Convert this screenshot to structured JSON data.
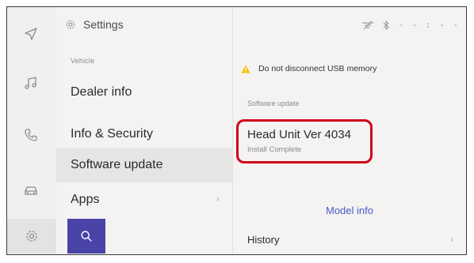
{
  "header": {
    "title": "Settings"
  },
  "status": {
    "clock": "- - : - -",
    "icons": [
      "signal-icon",
      "bluetooth-icon"
    ]
  },
  "menu": {
    "section_label": "Vehicle",
    "items": [
      {
        "label": "Dealer info"
      },
      {
        "label": "Info & Security"
      },
      {
        "label": "Software update",
        "selected": true
      },
      {
        "label": "Apps",
        "chevron": "›"
      }
    ]
  },
  "rail": {
    "icons": [
      "navigation-icon",
      "music-icon",
      "phone-icon",
      "car-icon",
      "settings-icon"
    ],
    "active": "settings-icon"
  },
  "content": {
    "warning": "Do not disconnect USB memory",
    "section_label": "Software update",
    "head_unit_title": "Head Unit Ver 4034",
    "head_unit_status": "Install Complete",
    "model_info": "Model info",
    "history": "History",
    "history_chevron": "›"
  },
  "colors": {
    "accent": "#4a44a8",
    "highlight": "#d0021b",
    "link": "#4a5ad0"
  }
}
